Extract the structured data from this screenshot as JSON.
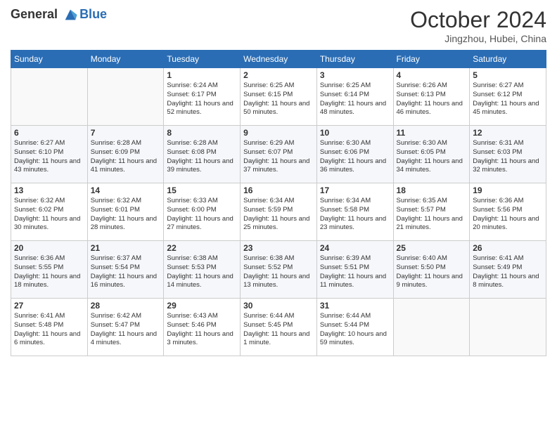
{
  "header": {
    "logo_line1": "General",
    "logo_line2": "Blue",
    "month": "October 2024",
    "location": "Jingzhou, Hubei, China"
  },
  "days_of_week": [
    "Sunday",
    "Monday",
    "Tuesday",
    "Wednesday",
    "Thursday",
    "Friday",
    "Saturday"
  ],
  "weeks": [
    [
      {
        "day": "",
        "info": ""
      },
      {
        "day": "",
        "info": ""
      },
      {
        "day": "1",
        "info": "Sunrise: 6:24 AM\nSunset: 6:17 PM\nDaylight: 11 hours and 52 minutes."
      },
      {
        "day": "2",
        "info": "Sunrise: 6:25 AM\nSunset: 6:15 PM\nDaylight: 11 hours and 50 minutes."
      },
      {
        "day": "3",
        "info": "Sunrise: 6:25 AM\nSunset: 6:14 PM\nDaylight: 11 hours and 48 minutes."
      },
      {
        "day": "4",
        "info": "Sunrise: 6:26 AM\nSunset: 6:13 PM\nDaylight: 11 hours and 46 minutes."
      },
      {
        "day": "5",
        "info": "Sunrise: 6:27 AM\nSunset: 6:12 PM\nDaylight: 11 hours and 45 minutes."
      }
    ],
    [
      {
        "day": "6",
        "info": "Sunrise: 6:27 AM\nSunset: 6:10 PM\nDaylight: 11 hours and 43 minutes."
      },
      {
        "day": "7",
        "info": "Sunrise: 6:28 AM\nSunset: 6:09 PM\nDaylight: 11 hours and 41 minutes."
      },
      {
        "day": "8",
        "info": "Sunrise: 6:28 AM\nSunset: 6:08 PM\nDaylight: 11 hours and 39 minutes."
      },
      {
        "day": "9",
        "info": "Sunrise: 6:29 AM\nSunset: 6:07 PM\nDaylight: 11 hours and 37 minutes."
      },
      {
        "day": "10",
        "info": "Sunrise: 6:30 AM\nSunset: 6:06 PM\nDaylight: 11 hours and 36 minutes."
      },
      {
        "day": "11",
        "info": "Sunrise: 6:30 AM\nSunset: 6:05 PM\nDaylight: 11 hours and 34 minutes."
      },
      {
        "day": "12",
        "info": "Sunrise: 6:31 AM\nSunset: 6:03 PM\nDaylight: 11 hours and 32 minutes."
      }
    ],
    [
      {
        "day": "13",
        "info": "Sunrise: 6:32 AM\nSunset: 6:02 PM\nDaylight: 11 hours and 30 minutes."
      },
      {
        "day": "14",
        "info": "Sunrise: 6:32 AM\nSunset: 6:01 PM\nDaylight: 11 hours and 28 minutes."
      },
      {
        "day": "15",
        "info": "Sunrise: 6:33 AM\nSunset: 6:00 PM\nDaylight: 11 hours and 27 minutes."
      },
      {
        "day": "16",
        "info": "Sunrise: 6:34 AM\nSunset: 5:59 PM\nDaylight: 11 hours and 25 minutes."
      },
      {
        "day": "17",
        "info": "Sunrise: 6:34 AM\nSunset: 5:58 PM\nDaylight: 11 hours and 23 minutes."
      },
      {
        "day": "18",
        "info": "Sunrise: 6:35 AM\nSunset: 5:57 PM\nDaylight: 11 hours and 21 minutes."
      },
      {
        "day": "19",
        "info": "Sunrise: 6:36 AM\nSunset: 5:56 PM\nDaylight: 11 hours and 20 minutes."
      }
    ],
    [
      {
        "day": "20",
        "info": "Sunrise: 6:36 AM\nSunset: 5:55 PM\nDaylight: 11 hours and 18 minutes."
      },
      {
        "day": "21",
        "info": "Sunrise: 6:37 AM\nSunset: 5:54 PM\nDaylight: 11 hours and 16 minutes."
      },
      {
        "day": "22",
        "info": "Sunrise: 6:38 AM\nSunset: 5:53 PM\nDaylight: 11 hours and 14 minutes."
      },
      {
        "day": "23",
        "info": "Sunrise: 6:38 AM\nSunset: 5:52 PM\nDaylight: 11 hours and 13 minutes."
      },
      {
        "day": "24",
        "info": "Sunrise: 6:39 AM\nSunset: 5:51 PM\nDaylight: 11 hours and 11 minutes."
      },
      {
        "day": "25",
        "info": "Sunrise: 6:40 AM\nSunset: 5:50 PM\nDaylight: 11 hours and 9 minutes."
      },
      {
        "day": "26",
        "info": "Sunrise: 6:41 AM\nSunset: 5:49 PM\nDaylight: 11 hours and 8 minutes."
      }
    ],
    [
      {
        "day": "27",
        "info": "Sunrise: 6:41 AM\nSunset: 5:48 PM\nDaylight: 11 hours and 6 minutes."
      },
      {
        "day": "28",
        "info": "Sunrise: 6:42 AM\nSunset: 5:47 PM\nDaylight: 11 hours and 4 minutes."
      },
      {
        "day": "29",
        "info": "Sunrise: 6:43 AM\nSunset: 5:46 PM\nDaylight: 11 hours and 3 minutes."
      },
      {
        "day": "30",
        "info": "Sunrise: 6:44 AM\nSunset: 5:45 PM\nDaylight: 11 hours and 1 minute."
      },
      {
        "day": "31",
        "info": "Sunrise: 6:44 AM\nSunset: 5:44 PM\nDaylight: 10 hours and 59 minutes."
      },
      {
        "day": "",
        "info": ""
      },
      {
        "day": "",
        "info": ""
      }
    ]
  ]
}
